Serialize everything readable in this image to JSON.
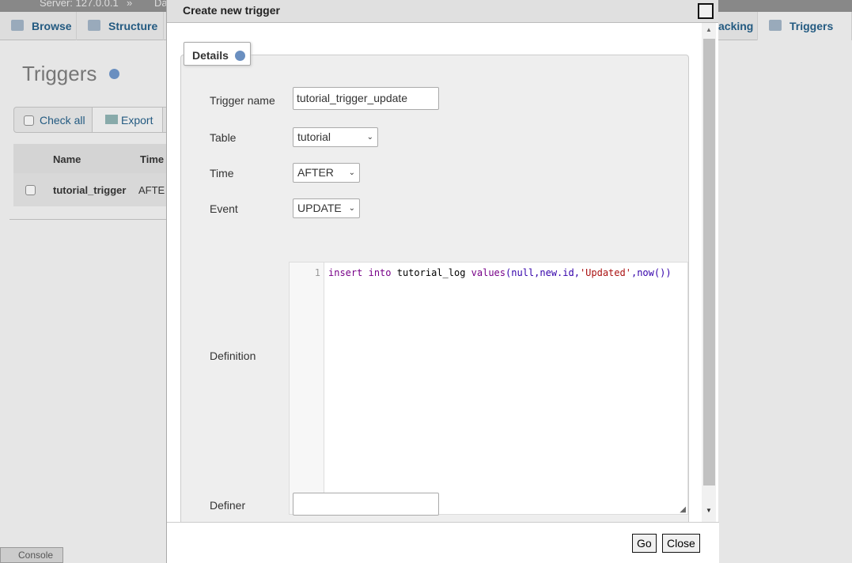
{
  "background": {
    "breadcrumb": {
      "server": "Server: 127.0.0.1",
      "sep": "»",
      "db": "Da"
    },
    "tabs": [
      {
        "label": "Browse"
      },
      {
        "label": "Structure"
      },
      {
        "label": "acking"
      },
      {
        "label": "Triggers"
      }
    ],
    "page_title": "Triggers",
    "check_all": "Check all",
    "export": "Export",
    "columns": [
      "Name",
      "Time"
    ],
    "rows": [
      {
        "name": "tutorial_trigger",
        "time": "AFTE"
      }
    ],
    "console": "Console"
  },
  "dialog": {
    "title": "Create new trigger",
    "legend": "Details",
    "fields": {
      "trigger_name_label": "Trigger name",
      "trigger_name": "tutorial_trigger_update",
      "table_label": "Table",
      "table": "tutorial",
      "time_label": "Time",
      "time": "AFTER",
      "event_label": "Event",
      "event": "UPDATE",
      "definition_label": "Definition",
      "definer_label": "Definer",
      "definer": ""
    },
    "code": {
      "line": "1",
      "t1": "insert",
      "t2": " ",
      "t3": "into",
      "t4": " tutorial_log ",
      "t5": "values",
      "t6": "(null,new.id,",
      "t7": "'Updated'",
      "t8": ",now())"
    },
    "go": "Go",
    "close": "Close"
  }
}
